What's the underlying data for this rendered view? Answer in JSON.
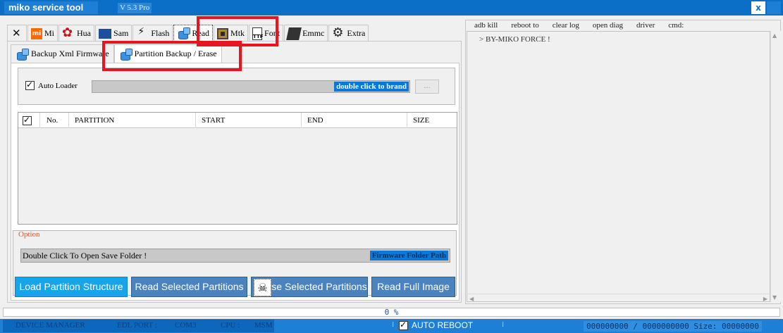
{
  "window": {
    "title": "miko service tool",
    "version": "V 5.3 Pro",
    "close_label": "x"
  },
  "main_tabs": [
    {
      "label": "",
      "icon": "tools-icon"
    },
    {
      "label": "Mi",
      "icon": "xiaomi-logo-icon"
    },
    {
      "label": "Hua",
      "icon": "huawei-logo-icon"
    },
    {
      "label": "Sam",
      "icon": "samsung-logo-icon"
    },
    {
      "label": "Flash",
      "icon": "lightning-icon"
    },
    {
      "label": "Read",
      "icon": "database-icon",
      "active": true
    },
    {
      "label": "Mtk",
      "icon": "chip-icon"
    },
    {
      "label": "Font",
      "icon": "font-file-icon"
    },
    {
      "label": "Emmc",
      "icon": "emmc-chip-icon"
    },
    {
      "label": "Extra",
      "icon": "gear-icon"
    }
  ],
  "sub_tabs": [
    {
      "label": "Backup Xml Firmware",
      "icon": "database-icon"
    },
    {
      "label": "Partition Backup / Erase",
      "icon": "database-icon",
      "active": true
    }
  ],
  "loader": {
    "checkbox_label": "Auto Loader",
    "checked": true,
    "brand_hint": "double click to brand",
    "browse_label": "..."
  },
  "partition_table": {
    "columns": [
      "No.",
      "PARTITION",
      "START",
      "END",
      "SIZE"
    ],
    "rows": []
  },
  "option": {
    "label": "Option",
    "folder_text": "Double Click To Open Save Folder !",
    "folder_path_label": "Firmware Folder Path"
  },
  "actions": {
    "load": "Load Partition Structure",
    "read_selected": "Read Selected Partitions",
    "erase_selected": "se Selected Partitions",
    "read_full": "Read Full Image"
  },
  "right_menu": [
    "adb kill",
    "reboot to",
    "clear log",
    "open diag",
    "driver",
    "cmd:"
  ],
  "log": {
    "line1": "> BY-MIKO FORCE !"
  },
  "progress": {
    "text": "0 %",
    "value": 0
  },
  "status": {
    "device_manager": "DEVICE MANAGER",
    "edl_port": "EDL PORT :",
    "com": "COM3",
    "cpu": "CPU :",
    "msm": "MSM",
    "auto_reboot": "AUTO REBOOT",
    "auto_reboot_checked": true,
    "counter": "000000000 / 0000000000 Size: 00000000"
  },
  "colors": {
    "titlebar": "#0b6fc7",
    "accent_blue": "#0a78d7",
    "button_blue": "#4a83bd",
    "button_active": "#17a4e8",
    "highlight_red": "#e8141e",
    "option_orange": "#e4552a"
  }
}
